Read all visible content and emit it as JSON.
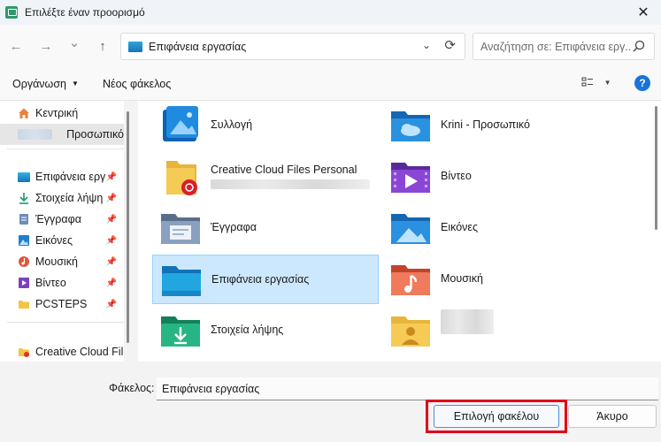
{
  "window": {
    "title": "Επιλέξτε έναν προορισμό",
    "close": "✕"
  },
  "nav": {
    "back": "←",
    "forward": "→",
    "recent": "⌄",
    "up": "↑",
    "address": "Επιφάνεια εργασίας",
    "refresh": "⟳",
    "search_placeholder": "Αναζήτηση σε: Επιφάνεια εργ..."
  },
  "commandbar": {
    "organize": "Οργάνωση",
    "new_folder": "Νέος φάκελος",
    "help": "?"
  },
  "sidebar": {
    "items": [
      {
        "label": "Κεντρική",
        "icon": "home-icon"
      },
      {
        "label": "Προσωπικό",
        "icon": "onedrive-icon"
      },
      {
        "label": "Επιφάνεια εργ",
        "icon": "desktop-icon",
        "pinned": true
      },
      {
        "label": "Στοιχεία λήψη",
        "icon": "download-icon",
        "pinned": true
      },
      {
        "label": "Έγγραφα",
        "icon": "documents-icon",
        "pinned": true
      },
      {
        "label": "Εικόνες",
        "icon": "pictures-icon",
        "pinned": true
      },
      {
        "label": "Μουσική",
        "icon": "music-icon",
        "pinned": true
      },
      {
        "label": "Βίντεο",
        "icon": "video-icon",
        "pinned": true
      },
      {
        "label": "PCSTEPS",
        "icon": "folder-icon",
        "pinned": true
      },
      {
        "label": "Creative Cloud File",
        "icon": "creative-cloud-icon"
      }
    ],
    "pin_glyph": "📌"
  },
  "folders": [
    {
      "name": "Συλλογή",
      "icon": "gallery-icon"
    },
    {
      "name": "Krini - Προσωπικό",
      "icon": "onedrive-folder-icon"
    },
    {
      "name": "Creative Cloud Files Personal",
      "icon": "creative-cloud-folder-icon"
    },
    {
      "name": "Βίντεο",
      "icon": "video-folder-icon"
    },
    {
      "name": "Έγγραφα",
      "icon": "documents-folder-icon"
    },
    {
      "name": "Εικόνες",
      "icon": "pictures-folder-icon"
    },
    {
      "name": "Επιφάνεια εργασίας",
      "icon": "desktop-folder-icon",
      "selected": true
    },
    {
      "name": "Μουσική",
      "icon": "music-folder-icon"
    },
    {
      "name": "Στοιχεία λήψης",
      "icon": "downloads-folder-icon"
    },
    {
      "name": "",
      "icon": "user-folder-icon"
    }
  ],
  "footer": {
    "folder_label": "Φάκελος:",
    "folder_value": "Επιφάνεια εργασίας",
    "select_button": "Επιλογή φακέλου",
    "cancel_button": "Άκυρο"
  },
  "colors": {
    "accent": "#1a73d6",
    "selection": "#cce8ff",
    "highlight_box": "#e0001b"
  }
}
